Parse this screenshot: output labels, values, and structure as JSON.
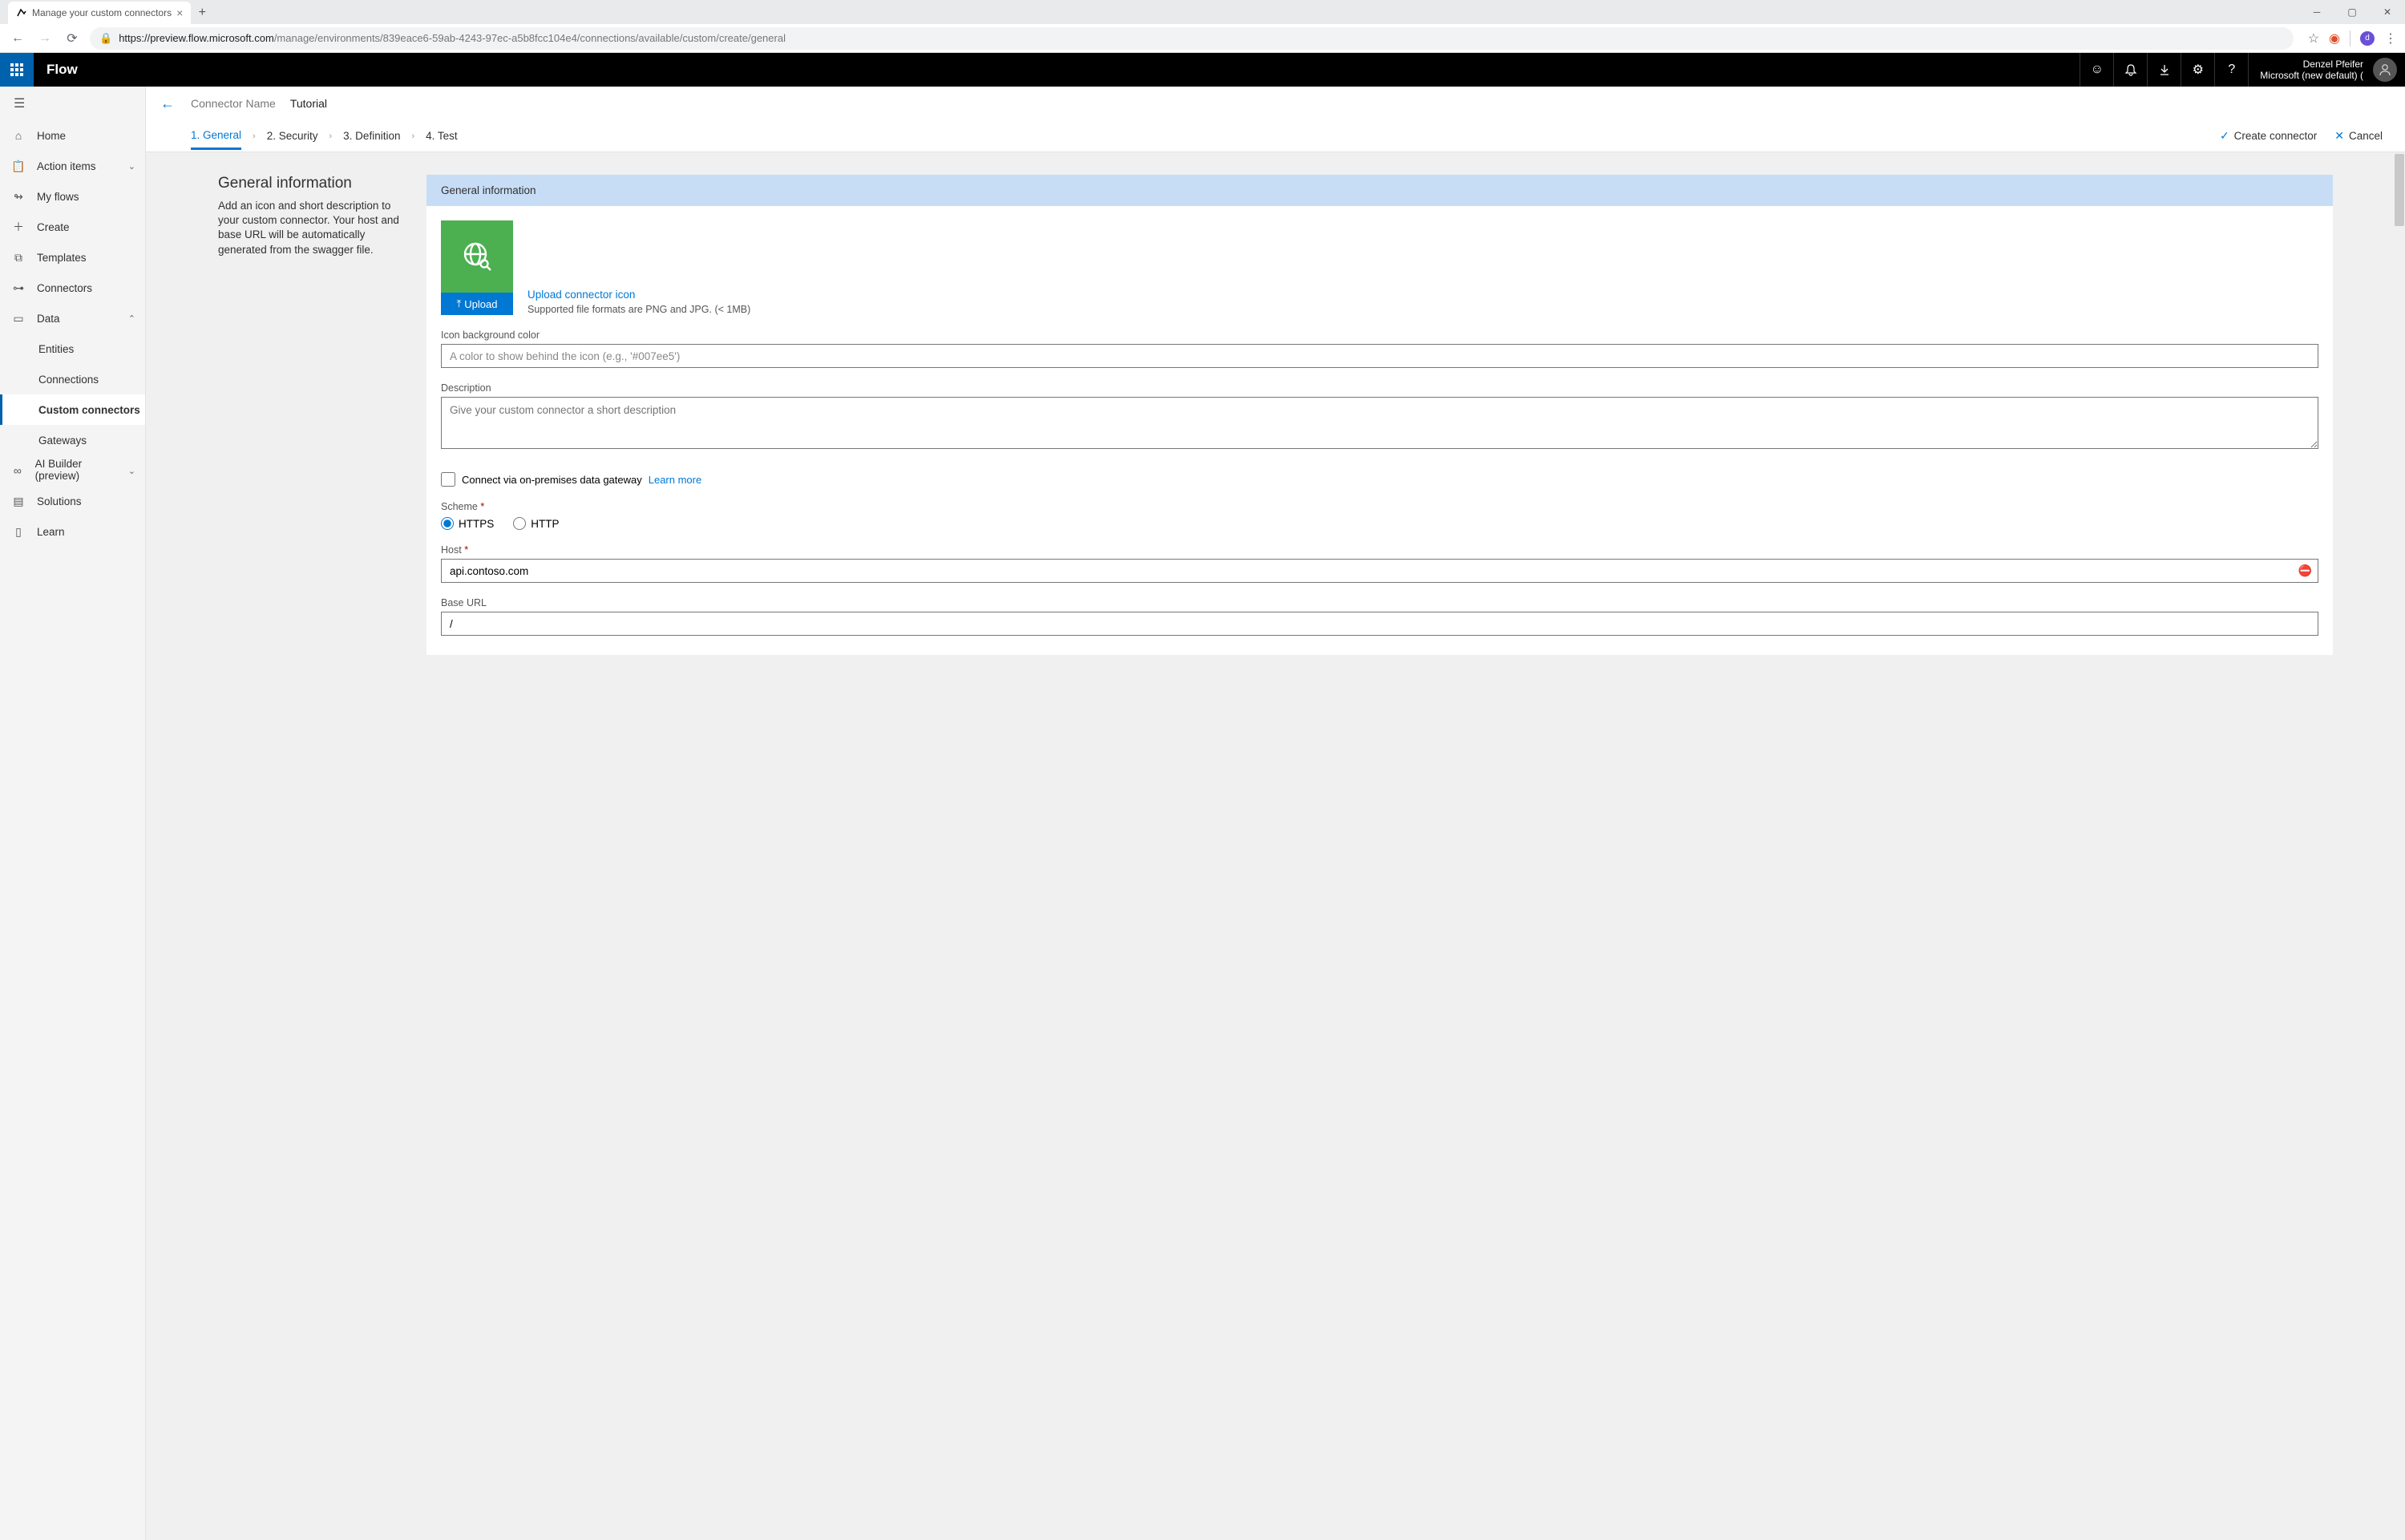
{
  "browser": {
    "tab_title": "Manage your custom connectors",
    "url_host": "https://preview.flow.microsoft.com",
    "url_path": "/manage/environments/839eace6-59ab-4243-97ec-a5b8fcc104e4/connections/available/custom/create/general",
    "profile_initial": "d"
  },
  "app": {
    "title": "Flow",
    "user_name": "Denzel Pfeifer",
    "user_env": "Microsoft (new default) ("
  },
  "sidebar": {
    "items": [
      {
        "label": "Home"
      },
      {
        "label": "Action items"
      },
      {
        "label": "My flows"
      },
      {
        "label": "Create"
      },
      {
        "label": "Templates"
      },
      {
        "label": "Connectors"
      },
      {
        "label": "Data"
      },
      {
        "label": "AI Builder (preview)"
      },
      {
        "label": "Solutions"
      },
      {
        "label": "Learn"
      }
    ],
    "data_sub": [
      {
        "label": "Entities"
      },
      {
        "label": "Connections"
      },
      {
        "label": "Custom connectors"
      },
      {
        "label": "Gateways"
      }
    ]
  },
  "header": {
    "label": "Connector Name",
    "value": "Tutorial"
  },
  "steps": {
    "s1": "1. General",
    "s2": "2. Security",
    "s3": "3. Definition",
    "s4": "4. Test",
    "create": "Create connector",
    "cancel": "Cancel"
  },
  "left": {
    "title": "General information",
    "desc": "Add an icon and short description to your custom connector. Your host and base URL will be automatically generated from the swagger file."
  },
  "card": {
    "header": "General information",
    "upload_label": "Upload",
    "upload_link": "Upload connector icon",
    "upload_hint": "Supported file formats are PNG and JPG. (< 1MB)",
    "icon_bg_label": "Icon background color",
    "icon_bg_placeholder": "A color to show behind the icon (e.g., '#007ee5')",
    "desc_label": "Description",
    "desc_placeholder": "Give your custom connector a short description",
    "gateway_label": "Connect via on-premises data gateway",
    "learn_more": "Learn more",
    "scheme_label": "Scheme",
    "scheme_https": "HTTPS",
    "scheme_http": "HTTP",
    "host_label": "Host",
    "host_value": "api.contoso.com",
    "baseurl_label": "Base URL",
    "baseurl_value": "/"
  }
}
